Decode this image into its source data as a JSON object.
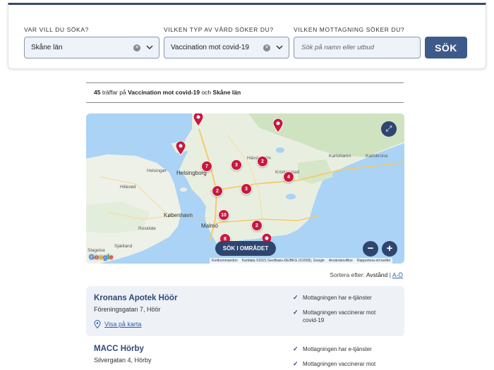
{
  "search": {
    "region_label": "VAR VILL DU SÖKA?",
    "region_value": "Skåne län",
    "care_label": "VILKEN TYP AV VÅRD SÖKER DU?",
    "care_value": "Vaccination mot covid-19",
    "clinic_label": "VILKEN MOTTAGNING SÖKER DU?",
    "clinic_placeholder": "Sök på namn eller utbud",
    "button_label": "SÖK"
  },
  "results": {
    "count": "45",
    "text_1": " träffar på ",
    "care": "Vaccination mot covid-19",
    "text_2": " och ",
    "region": "Skåne län"
  },
  "map": {
    "area_button": "SÖK I OMRÅDET",
    "labels": {
      "helsingborg": "Helsingborg",
      "kopenhamn": "København",
      "malmo": "Malmö",
      "hillerod": "Hillerød",
      "roskilde": "Roskilde",
      "slagelse": "Slagelse",
      "sjaelland": "Sjælland",
      "helsingor": "Helsingør",
      "karlshamn": "Karlshamn",
      "karlskrona": "Karlskrona",
      "kristianstad": "Kristianstad",
      "hassleholm": "Hässleholm"
    },
    "cluster_counts": [
      "7",
      "3",
      "2",
      "2",
      "3",
      "4",
      "10",
      "2",
      "8"
    ],
    "attribution": {
      "shortcuts": "Kortkommandon",
      "data": "Kartdata ©2021 GeoBasis-DE/BKG (©2009), Google",
      "terms": "Användarvillkor",
      "report": "Rapportera ett kartfel"
    }
  },
  "sort": {
    "label": "Sortera efter:",
    "option_distance": "Avstånd",
    "separator": "|",
    "option_az": "A-Ö"
  },
  "cards": [
    {
      "name": "Kronans Apotek Höör",
      "address": "Föreningsgatan 7, Höör",
      "map_link": "Visa på karta",
      "features": [
        "Mottagningen har e-tjänster",
        "Mottagningen vaccinerar mot covid-19"
      ]
    },
    {
      "name": "MACC Hörby",
      "address": "Silvergatan 4, Hörby",
      "features": [
        "Mottagningen har e-tjänster",
        "Mottagningen vaccinerar mot"
      ]
    }
  ],
  "colors": {
    "brand": "#3e5a8a",
    "pin": "#c7193f",
    "title": "#2d4a7a"
  }
}
